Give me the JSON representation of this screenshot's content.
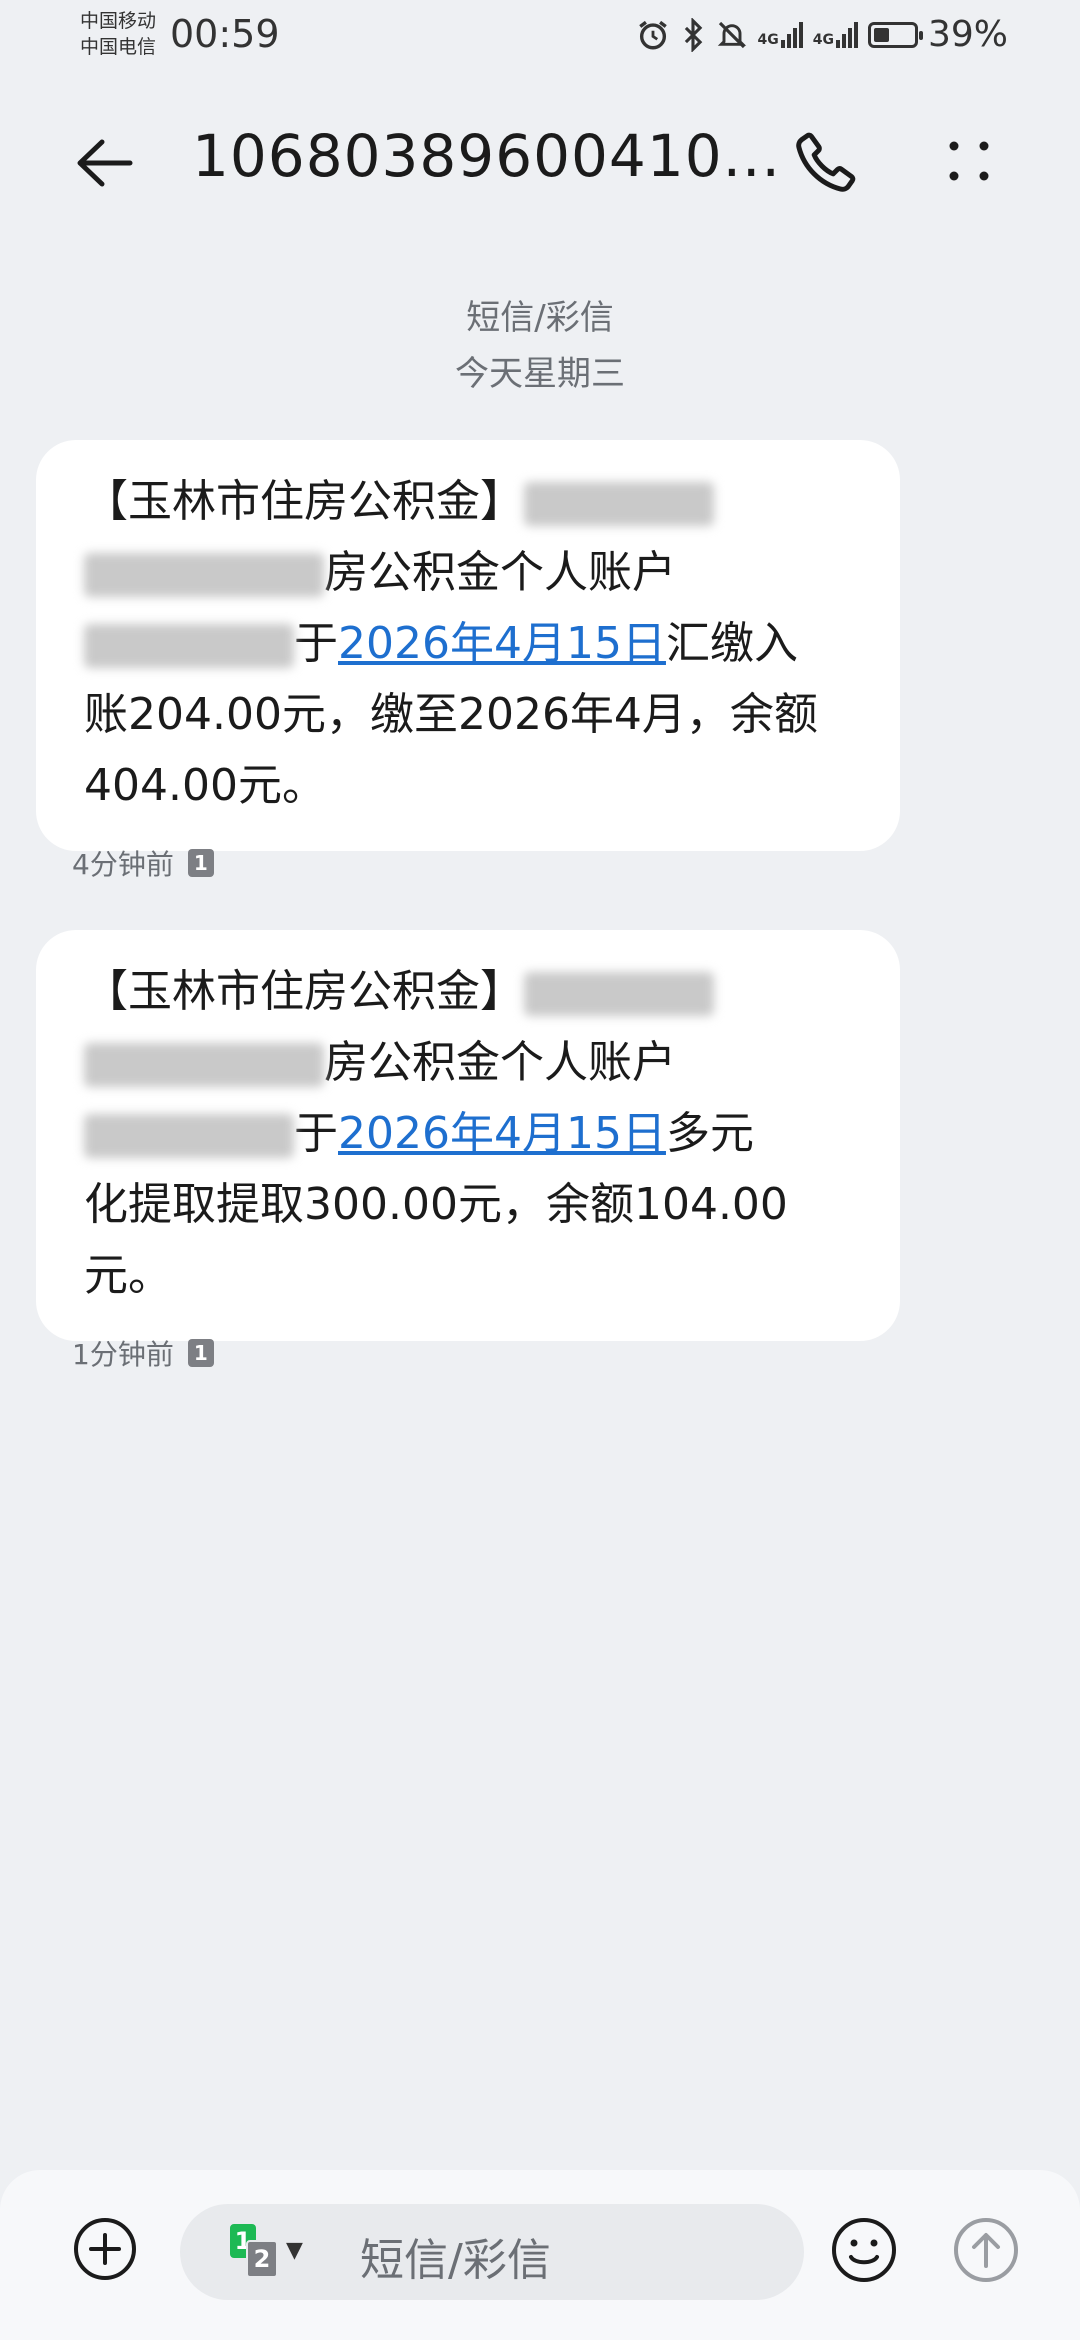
{
  "status_bar": {
    "carrier1": "中国移动",
    "carrier2": "中国电信",
    "time": "00:59",
    "net1": "4G",
    "net2": "4G",
    "battery_percent_text": "39%",
    "battery_level": 0.39
  },
  "header": {
    "title": "10680389600410..."
  },
  "conversation": {
    "channel_label": "短信/彩信",
    "date_label": "今天星期三"
  },
  "messages": [
    {
      "line1": "【玉林市住房公积金】",
      "line2": "房公积金个人账户",
      "line3_pre": "于",
      "line3_link": "2026年4月15日",
      "line3_post": "汇缴入",
      "line4": "账204.00元，缴至2026年4月，余额",
      "line5": "404.00元。",
      "time": "4分钟前",
      "sim": "1"
    },
    {
      "line1": "【玉林市住房公积金】",
      "line2": "房公积金个人账户",
      "line3_pre": "于",
      "line3_link": "2026年4月15日",
      "line3_post": "多元",
      "line4": "化提取提取300.00元，余额104.00",
      "line5": "元。",
      "time": "1分钟前",
      "sim": "1"
    }
  ],
  "composer": {
    "placeholder": "短信/彩信",
    "sim1": "1",
    "sim2": "2"
  },
  "icons": {
    "back": "arrow-left-icon",
    "call": "phone-icon",
    "more": "more-vertical-icon",
    "add": "plus-circle-icon",
    "emoji": "smile-icon",
    "send": "arrow-up-circle-icon"
  }
}
